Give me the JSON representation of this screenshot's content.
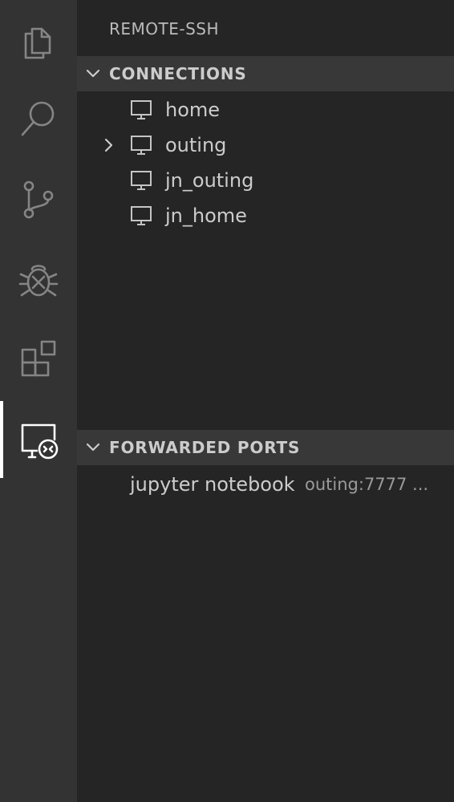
{
  "activity_bar": {
    "items": [
      {
        "icon": "files-icon",
        "active": false
      },
      {
        "icon": "search-icon",
        "active": false
      },
      {
        "icon": "source-control-icon",
        "active": false
      },
      {
        "icon": "debug-icon",
        "active": false
      },
      {
        "icon": "extensions-icon",
        "active": false
      },
      {
        "icon": "remote-explorer-icon",
        "active": true
      }
    ]
  },
  "sidebar": {
    "title": "REMOTE-SSH",
    "connections": {
      "label": "CONNECTIONS",
      "expanded": true,
      "items": [
        {
          "name": "home",
          "expandable": false
        },
        {
          "name": "outing",
          "expandable": true
        },
        {
          "name": "jn_outing",
          "expandable": false
        },
        {
          "name": "jn_home",
          "expandable": false
        }
      ]
    },
    "forwarded_ports": {
      "label": "FORWARDED PORTS",
      "expanded": true,
      "items": [
        {
          "name": "jupyter notebook",
          "description": "outing:7777 ..."
        }
      ]
    }
  },
  "colors": {
    "activity_bar_bg": "#333333",
    "sidebar_bg": "#252526",
    "section_header_bg": "#383838",
    "text": "#cccccc",
    "muted_text": "#9a9a9a"
  }
}
